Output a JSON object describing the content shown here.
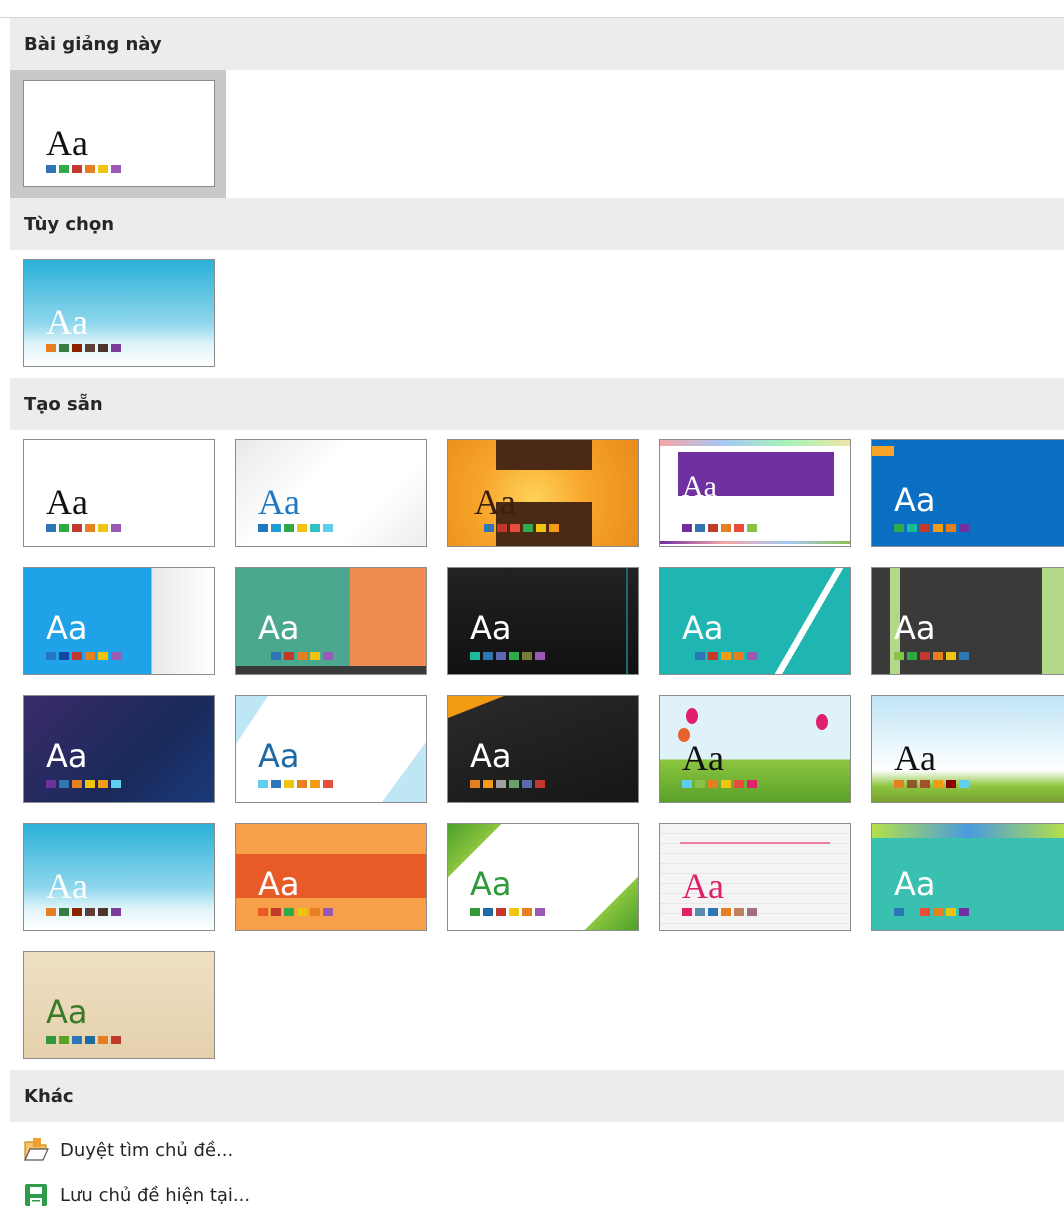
{
  "sections": {
    "this_presentation": "Bài giảng này",
    "custom": "Tùy chọn",
    "builtin": "Tạo sẵn",
    "other": "Khác"
  },
  "theme_sample_text": "Aa",
  "menu": {
    "browse": "Duyệt tìm chủ đề...",
    "save": "Lưu chủ đề hiện tại..."
  },
  "colors": {
    "header_bg": "#ececec",
    "selected_bg": "#c8c8c8",
    "browse_icon": "#f0a030",
    "save_icon": "#2e9c4a"
  },
  "icons": {
    "browse": "open-folder-icon",
    "save": "save-floppy-icon"
  }
}
